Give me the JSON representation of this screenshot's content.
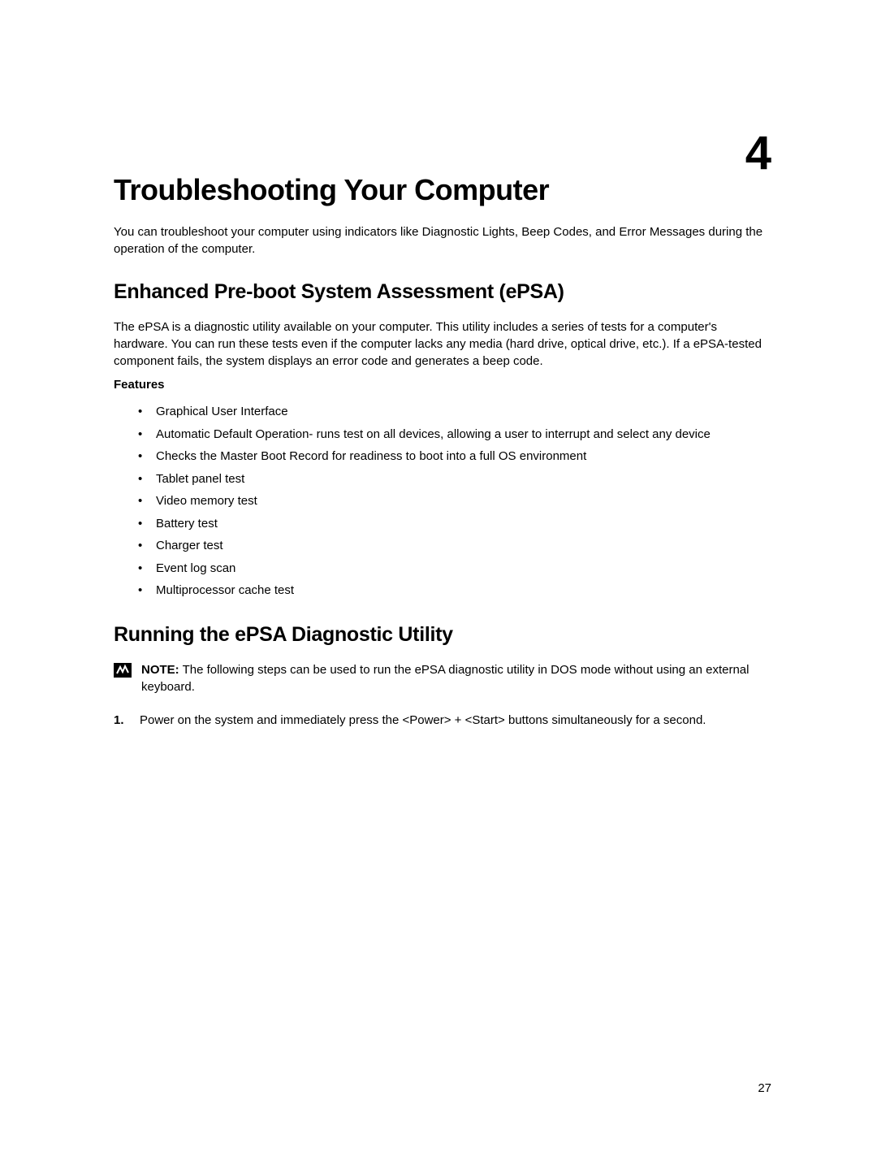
{
  "chapter_number": "4",
  "main_title": "Troubleshooting Your Computer",
  "intro_text": "You can troubleshoot your computer using indicators like Diagnostic Lights, Beep Codes, and Error Messages during the operation of the computer.",
  "section1": {
    "title": "Enhanced Pre-boot System Assessment (ePSA)",
    "text": "The ePSA is a diagnostic utility available on your computer. This utility includes a series of tests for a computer's hardware. You can run these tests even if the computer lacks any media (hard drive, optical drive, etc.). If a ePSA-tested component fails, the system displays an error code and generates a beep code.",
    "features_heading": "Features",
    "features": [
      "Graphical User Interface",
      "Automatic Default Operation- runs test on all devices, allowing a user to interrupt and select any device",
      "Checks the Master Boot Record for readiness to boot into a full OS environment",
      "Tablet panel test",
      "Video memory test",
      "Battery test",
      "Charger test",
      "Event log scan",
      "Multiprocessor cache test"
    ]
  },
  "section2": {
    "title": "Running the ePSA Diagnostic Utility",
    "note_label": "NOTE:",
    "note_text": " The following steps can be used to run the ePSA diagnostic utility in DOS mode without using an external keyboard.",
    "steps": [
      {
        "number": "1.",
        "text": "Power on the system and immediately press the <Power> + <Start> buttons simultaneously for a second."
      }
    ]
  },
  "page_number": "27"
}
